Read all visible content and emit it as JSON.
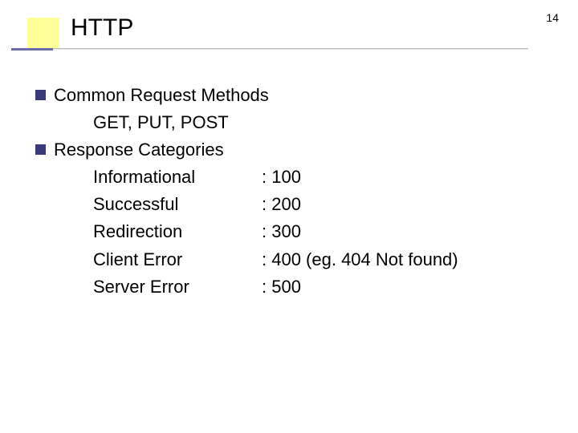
{
  "pageNumber": "14",
  "title": "HTTP",
  "bullets": {
    "b1": "Common Request Methods",
    "b1sub": "GET, PUT, POST",
    "b2": "Response Categories"
  },
  "responseCategories": [
    {
      "label": "Informational",
      "code": ": 100"
    },
    {
      "label": "Successful",
      "code": ": 200"
    },
    {
      "label": "Redirection",
      "code": ": 300"
    },
    {
      "label": "Client Error",
      "code": ": 400 (eg. 404 Not found)"
    },
    {
      "label": "Server Error",
      "code": ": 500"
    }
  ]
}
